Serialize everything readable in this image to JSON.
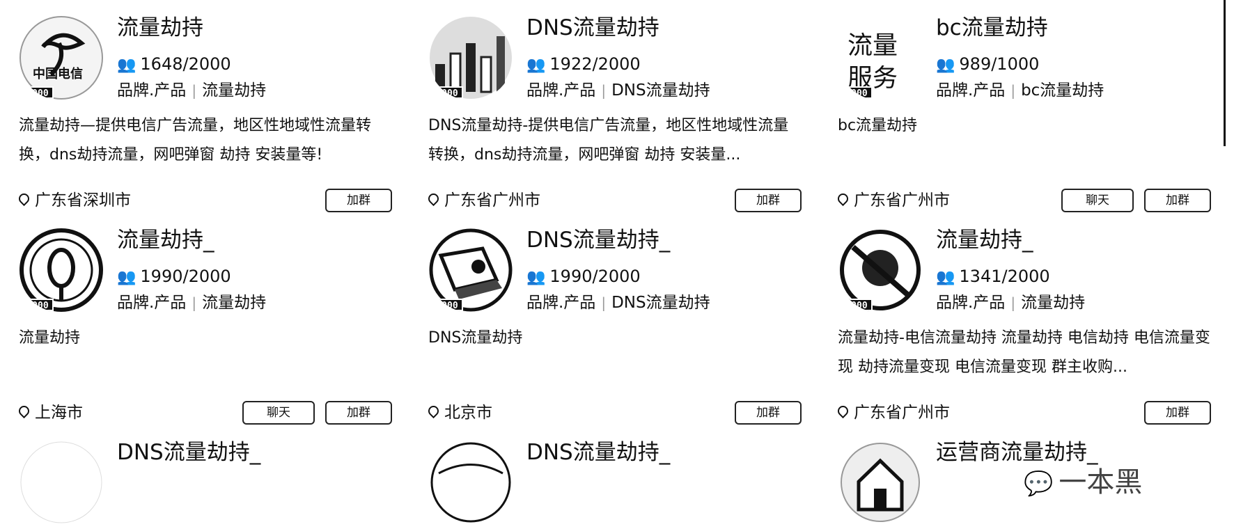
{
  "cards": [
    {
      "name": "流量劫持",
      "members": "1648/2000",
      "capacity": "2000",
      "tags": [
        "品牌.产品",
        "流量劫持"
      ],
      "description": "流量劫持—提供电信广告流量，地区性地域性流量转换，dns劫持流量，网吧弹窗 劫持 安装量等!",
      "location": "广东省深圳市",
      "join_label": "加群",
      "avatar": "china-telecom-logo"
    },
    {
      "name": "DNS流量劫持",
      "members": "1922/2000",
      "capacity": "2000",
      "tags": [
        "品牌.产品",
        "DNS流量劫持"
      ],
      "description": "DNS流量劫持-提供电信广告流量，地区性地域性流量转换，dns劫持流量，网吧弹窗 劫持 安装量...",
      "location": "广东省广州市",
      "join_label": "加群",
      "avatar": "bar-chart-photo"
    },
    {
      "name": "bc流量劫持",
      "members": "989/1000",
      "capacity": "1000",
      "tags": [
        "品牌.产品",
        "bc流量劫持"
      ],
      "description": "bc流量劫持",
      "location": "广东省广州市",
      "chat_label": "聊天",
      "join_label": "加群",
      "avatar": "traffic-service-text",
      "avatar_text": [
        "流量",
        "服务"
      ]
    },
    {
      "name": "流量劫持_",
      "members": "1990/2000",
      "capacity": "2000",
      "tags": [
        "品牌.产品",
        "流量劫持"
      ],
      "description": "流量劫持",
      "location": "上海市",
      "chat_label": "聊天",
      "join_label": "加群",
      "avatar": "emblem-logo"
    },
    {
      "name": "DNS流量劫持_",
      "members": "1990/2000",
      "capacity": "2000",
      "tags": [
        "品牌.产品",
        "DNS流量劫持"
      ],
      "description": "DNS流量劫持",
      "location": "北京市",
      "join_label": "加群",
      "avatar": "laptop-photo"
    },
    {
      "name": "流量劫持_",
      "members": "1341/2000",
      "capacity": "2000",
      "tags": [
        "品牌.产品",
        "流量劫持"
      ],
      "description": "流量劫持-电信流量劫持 流量劫持 电信劫持 电信流量变现 劫持流量变现 电信流量变现 群主收购...",
      "location": "广东省广州市",
      "join_label": "加群",
      "avatar": "prohibited-sign"
    },
    {
      "name": "DNS流量劫持_",
      "avatar": "blank"
    },
    {
      "name": "DNS流量劫持_",
      "avatar": "dns-badge"
    },
    {
      "name": "运营商流量劫持_",
      "avatar": "house-photo"
    }
  ],
  "watermark": {
    "text": "一本黑",
    "icon": "wechat-icon"
  }
}
